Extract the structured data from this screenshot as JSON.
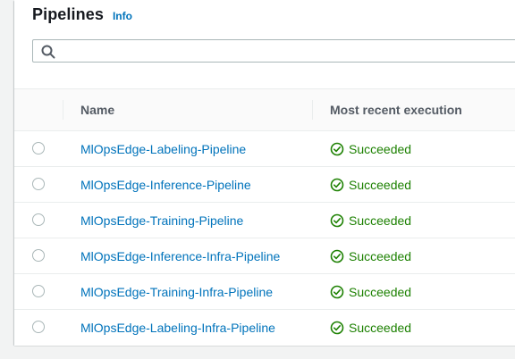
{
  "header": {
    "title": "Pipelines",
    "info_label": "Info"
  },
  "search": {
    "placeholder": "",
    "value": ""
  },
  "table": {
    "columns": {
      "name": "Name",
      "execution": "Most recent execution"
    },
    "rows": [
      {
        "name": "MlOpsEdge-Labeling-Pipeline",
        "status": "Succeeded"
      },
      {
        "name": "MlOpsEdge-Inference-Pipeline",
        "status": "Succeeded"
      },
      {
        "name": "MlOpsEdge-Training-Pipeline",
        "status": "Succeeded"
      },
      {
        "name": "MlOpsEdge-Inference-Infra-Pipeline",
        "status": "Succeeded"
      },
      {
        "name": "MlOpsEdge-Training-Infra-Pipeline",
        "status": "Succeeded"
      },
      {
        "name": "MlOpsEdge-Labeling-Infra-Pipeline",
        "status": "Succeeded"
      }
    ]
  },
  "colors": {
    "link": "#0073bb",
    "success": "#1d8102",
    "header_text": "#545b64"
  },
  "icons": {
    "search": "search-icon",
    "status": "check-circle-icon"
  }
}
